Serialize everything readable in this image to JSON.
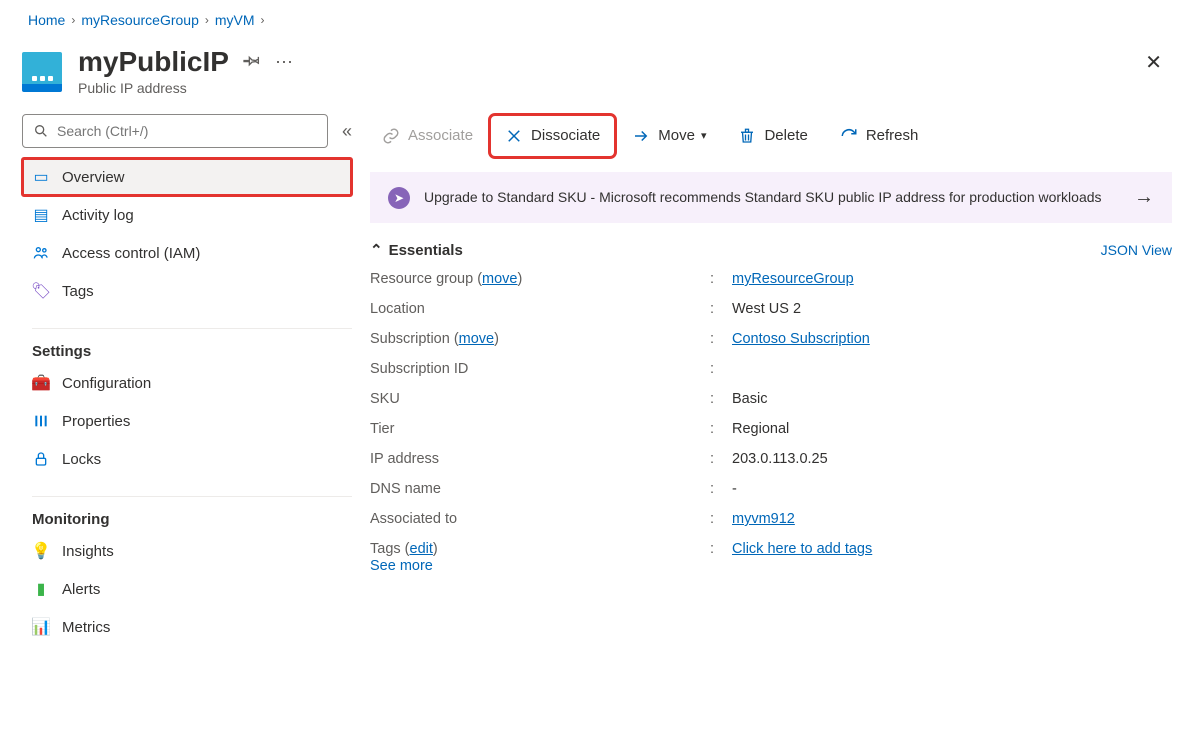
{
  "breadcrumb": {
    "home": "Home",
    "rg": "myResourceGroup",
    "vm": "myVM"
  },
  "header": {
    "title": "myPublicIP",
    "subtitle": "Public IP address"
  },
  "sidebar": {
    "search_placeholder": "Search (Ctrl+/)",
    "items": {
      "overview": "Overview",
      "activity": "Activity log",
      "iam": "Access control (IAM)",
      "tags": "Tags"
    },
    "sections": {
      "settings": "Settings",
      "monitoring": "Monitoring"
    },
    "settings_items": {
      "configuration": "Configuration",
      "properties": "Properties",
      "locks": "Locks"
    },
    "monitoring_items": {
      "insights": "Insights",
      "alerts": "Alerts",
      "metrics": "Metrics"
    }
  },
  "commands": {
    "associate": "Associate",
    "dissociate": "Dissociate",
    "move": "Move",
    "delete": "Delete",
    "refresh": "Refresh"
  },
  "banner": {
    "text": "Upgrade to Standard SKU - Microsoft recommends Standard SKU public IP address for production workloads"
  },
  "essentials": {
    "title": "Essentials",
    "json_view": "JSON View",
    "labels": {
      "resource_group": "Resource group",
      "move": "move",
      "location": "Location",
      "subscription": "Subscription",
      "subscription_id": "Subscription ID",
      "sku": "SKU",
      "tier": "Tier",
      "ip_address": "IP address",
      "dns_name": "DNS name",
      "associated_to": "Associated to",
      "tags": "Tags",
      "edit": "edit"
    },
    "values": {
      "resource_group": "myResourceGroup",
      "location": "West US 2",
      "subscription": "Contoso Subscription",
      "subscription_id": "",
      "sku": "Basic",
      "tier": "Regional",
      "ip_address": "203.0.113.0.25",
      "dns_name": "-",
      "associated_to": "myvm912",
      "tags": "Click here to add tags"
    },
    "see_more": "See more"
  }
}
